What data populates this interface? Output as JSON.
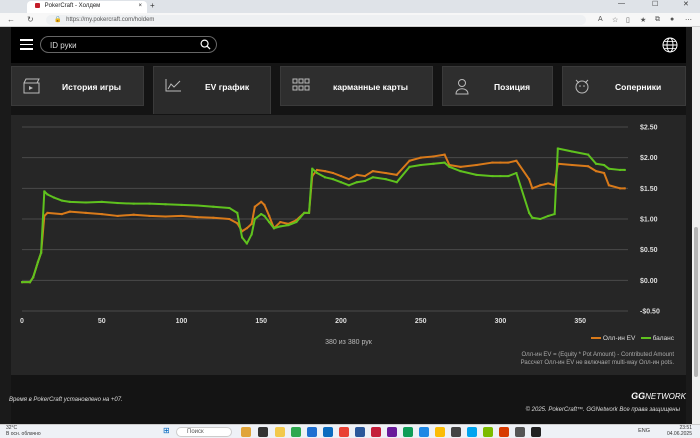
{
  "browser": {
    "tab_title": "PokerCraft - Холдем",
    "tab_close": "×",
    "new_tab": "+",
    "url": "https://my.pokercraft.com/holdem",
    "back": "←",
    "reload": "↻",
    "minimize": "—",
    "maximize": "☐",
    "close": "✕"
  },
  "header": {
    "search_placeholder": "ID руки"
  },
  "tabs": [
    {
      "label": "История игры",
      "icon": "clapperboard-icon"
    },
    {
      "label": "EV график",
      "icon": "line-chart-icon"
    },
    {
      "label": "карманные карты",
      "icon": "grid-icon"
    },
    {
      "label": "Позиция",
      "icon": "seat-icon"
    },
    {
      "label": "Соперники",
      "icon": "cat-face-icon"
    }
  ],
  "active_tab": "EV график",
  "chart_data": {
    "type": "line",
    "x_ticks": [
      0,
      50,
      100,
      150,
      200,
      250,
      300,
      350
    ],
    "y_ticks": [
      "-$0.50",
      "$0.00",
      "$0.50",
      "$1.00",
      "$1.50",
      "$2.00",
      "$2.50"
    ],
    "xlim": [
      0,
      380
    ],
    "ylim": [
      -0.5,
      2.5
    ],
    "grid": true,
    "legend_position": "bottom-right",
    "series": [
      {
        "name": "Олл-ин EV",
        "color": "#d97a1a",
        "points": [
          [
            0,
            -0.03
          ],
          [
            5,
            -0.03
          ],
          [
            7,
            0.05
          ],
          [
            10,
            0.3
          ],
          [
            12,
            0.45
          ],
          [
            14,
            1.05
          ],
          [
            16,
            1.1
          ],
          [
            25,
            1.08
          ],
          [
            30,
            1.12
          ],
          [
            40,
            1.1
          ],
          [
            50,
            1.08
          ],
          [
            60,
            1.05
          ],
          [
            70,
            1.07
          ],
          [
            80,
            1.05
          ],
          [
            90,
            1.04
          ],
          [
            100,
            1.05
          ],
          [
            110,
            1.03
          ],
          [
            120,
            1.02
          ],
          [
            130,
            1.0
          ],
          [
            135,
            0.93
          ],
          [
            138,
            0.8
          ],
          [
            141,
            0.85
          ],
          [
            144,
            0.92
          ],
          [
            146,
            1.2
          ],
          [
            150,
            1.28
          ],
          [
            152,
            1.23
          ],
          [
            155,
            1.05
          ],
          [
            158,
            0.85
          ],
          [
            162,
            0.95
          ],
          [
            167,
            0.92
          ],
          [
            172,
            0.98
          ],
          [
            177,
            1.1
          ],
          [
            180,
            1.1
          ],
          [
            182,
            1.7
          ],
          [
            185,
            1.8
          ],
          [
            190,
            1.78
          ],
          [
            195,
            1.75
          ],
          [
            200,
            1.7
          ],
          [
            205,
            1.65
          ],
          [
            210,
            1.72
          ],
          [
            215,
            1.7
          ],
          [
            220,
            1.78
          ],
          [
            228,
            1.75
          ],
          [
            235,
            1.72
          ],
          [
            243,
            1.95
          ],
          [
            250,
            2.0
          ],
          [
            258,
            2.02
          ],
          [
            265,
            2.05
          ],
          [
            268,
            1.88
          ],
          [
            275,
            1.85
          ],
          [
            285,
            1.88
          ],
          [
            295,
            1.92
          ],
          [
            300,
            1.92
          ],
          [
            305,
            1.92
          ],
          [
            310,
            1.95
          ],
          [
            318,
            1.65
          ],
          [
            320,
            1.5
          ],
          [
            325,
            1.55
          ],
          [
            330,
            1.58
          ],
          [
            334,
            1.55
          ],
          [
            336,
            1.9
          ],
          [
            345,
            1.88
          ],
          [
            355,
            1.86
          ],
          [
            360,
            1.78
          ],
          [
            365,
            1.75
          ],
          [
            368,
            1.55
          ],
          [
            375,
            1.5
          ],
          [
            378,
            1.5
          ]
        ]
      },
      {
        "name": "баланс",
        "color": "#5fc21e",
        "points": [
          [
            0,
            -0.03
          ],
          [
            5,
            -0.03
          ],
          [
            7,
            0.05
          ],
          [
            10,
            0.3
          ],
          [
            12,
            0.45
          ],
          [
            14,
            1.45
          ],
          [
            16,
            1.4
          ],
          [
            20,
            1.35
          ],
          [
            25,
            1.3
          ],
          [
            30,
            1.28
          ],
          [
            40,
            1.27
          ],
          [
            50,
            1.28
          ],
          [
            60,
            1.26
          ],
          [
            70,
            1.25
          ],
          [
            80,
            1.25
          ],
          [
            90,
            1.24
          ],
          [
            100,
            1.23
          ],
          [
            110,
            1.22
          ],
          [
            120,
            1.2
          ],
          [
            130,
            1.18
          ],
          [
            135,
            1.1
          ],
          [
            138,
            0.7
          ],
          [
            141,
            0.6
          ],
          [
            144,
            0.75
          ],
          [
            146,
            1.0
          ],
          [
            150,
            1.08
          ],
          [
            152,
            1.05
          ],
          [
            155,
            0.95
          ],
          [
            158,
            0.85
          ],
          [
            162,
            0.88
          ],
          [
            167,
            0.9
          ],
          [
            172,
            0.95
          ],
          [
            177,
            1.1
          ],
          [
            180,
            1.1
          ],
          [
            182,
            1.82
          ],
          [
            185,
            1.75
          ],
          [
            190,
            1.68
          ],
          [
            195,
            1.65
          ],
          [
            200,
            1.6
          ],
          [
            205,
            1.55
          ],
          [
            210,
            1.6
          ],
          [
            215,
            1.62
          ],
          [
            220,
            1.68
          ],
          [
            228,
            1.65
          ],
          [
            235,
            1.6
          ],
          [
            243,
            1.85
          ],
          [
            250,
            1.88
          ],
          [
            258,
            1.9
          ],
          [
            265,
            1.92
          ],
          [
            268,
            1.85
          ],
          [
            275,
            1.78
          ],
          [
            285,
            1.72
          ],
          [
            295,
            1.7
          ],
          [
            300,
            1.7
          ],
          [
            305,
            1.7
          ],
          [
            310,
            1.75
          ],
          [
            318,
            1.1
          ],
          [
            320,
            1.02
          ],
          [
            325,
            1.0
          ],
          [
            330,
            1.05
          ],
          [
            334,
            1.08
          ],
          [
            336,
            2.15
          ],
          [
            345,
            2.1
          ],
          [
            355,
            2.05
          ],
          [
            360,
            1.9
          ],
          [
            365,
            1.88
          ],
          [
            368,
            1.82
          ],
          [
            375,
            1.8
          ],
          [
            378,
            1.8
          ]
        ]
      }
    ]
  },
  "hand_counter": "380 из 380 рук",
  "legend_series": [
    "Олл-ин EV",
    "баланс"
  ],
  "legend_note_1": "Олл-ин EV = (Equity * Pot Amount) - Contributed Amount",
  "legend_note_2": "Рассчет Олл-ин EV не включает multi-way Олл-ин pots.",
  "footer": {
    "timezone_note": "Время в PokerCraft установлено на +07.",
    "copyright": "© 2025. PokerCraft™. GGNetwork Все права защищены",
    "brand_gg": "GG",
    "brand_network": "NETWORK"
  },
  "taskbar": {
    "weather_temp": "32°C",
    "weather_desc": "В осн. облачно",
    "search_placeholder": "Поиск",
    "lang": "ENG",
    "time": "23:51",
    "date": "04.06.2025"
  }
}
